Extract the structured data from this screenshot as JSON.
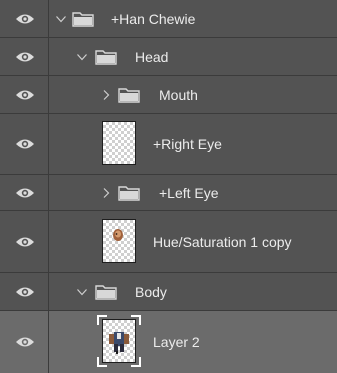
{
  "layers": [
    {
      "label": "+Han Chewie",
      "type": "group",
      "expanded": true,
      "indent": 0,
      "icon": "folder-icon"
    },
    {
      "label": "Head",
      "type": "group",
      "expanded": true,
      "indent": 1,
      "icon": "folder-icon"
    },
    {
      "label": "Mouth",
      "type": "group",
      "expanded": false,
      "indent": 2,
      "icon": "folder-icon"
    },
    {
      "label": "+Right Eye",
      "type": "layer",
      "thumbnail": "transparent",
      "indent": 2
    },
    {
      "label": "+Left Eye",
      "type": "group",
      "expanded": false,
      "indent": 2,
      "icon": "folder-icon"
    },
    {
      "label": "Hue/Saturation 1 copy",
      "type": "layer",
      "thumbnail": "face-bits",
      "indent": 2
    },
    {
      "label": "Body",
      "type": "group",
      "expanded": true,
      "indent": 1,
      "icon": "folder-icon"
    },
    {
      "label": "Layer 2",
      "type": "layer",
      "thumbnail": "body-figure",
      "indent": 2,
      "selected": true
    }
  ],
  "colors": {
    "panel_bg": "#535353",
    "selected_bg": "#6b6b6b",
    "divider": "#3b3b3b",
    "text": "#ececec"
  }
}
